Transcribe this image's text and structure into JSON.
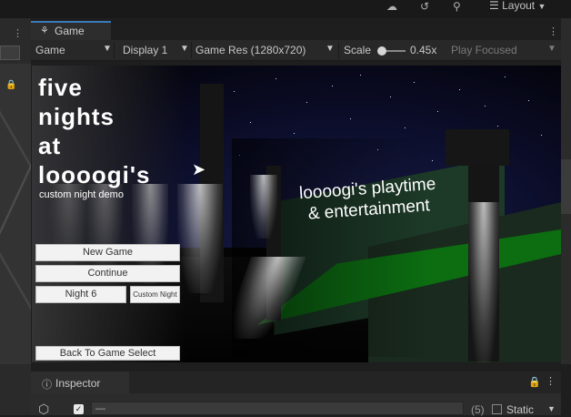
{
  "editor": {
    "layout_label": "Layout",
    "top_icons": [
      "cloud-icon",
      "history-icon",
      "search-icon"
    ]
  },
  "game_tab": {
    "label": "Game",
    "icon": "gamepad-icon"
  },
  "toolbar": {
    "view_select": "Game",
    "display_select": "Display 1",
    "resolution_select": "Game Res (1280x720)",
    "scale_label": "Scale",
    "scale_value": "0.45x",
    "play_mode_select": "Play Focused"
  },
  "game": {
    "title": "five\nnights\nat\nloooogi's",
    "subtitle": "custom night demo",
    "sign": "loooogi's playtime\n& entertainment",
    "buttons": {
      "new_game": "New Game",
      "continue": "Continue",
      "night": "Night 6",
      "custom_night": "Custom Night",
      "back": "Back To Game Select"
    }
  },
  "inspector": {
    "tab_label": "Inspector",
    "name_value": "—",
    "count": "(5)",
    "static_label": "Static",
    "active": true,
    "static": false
  }
}
